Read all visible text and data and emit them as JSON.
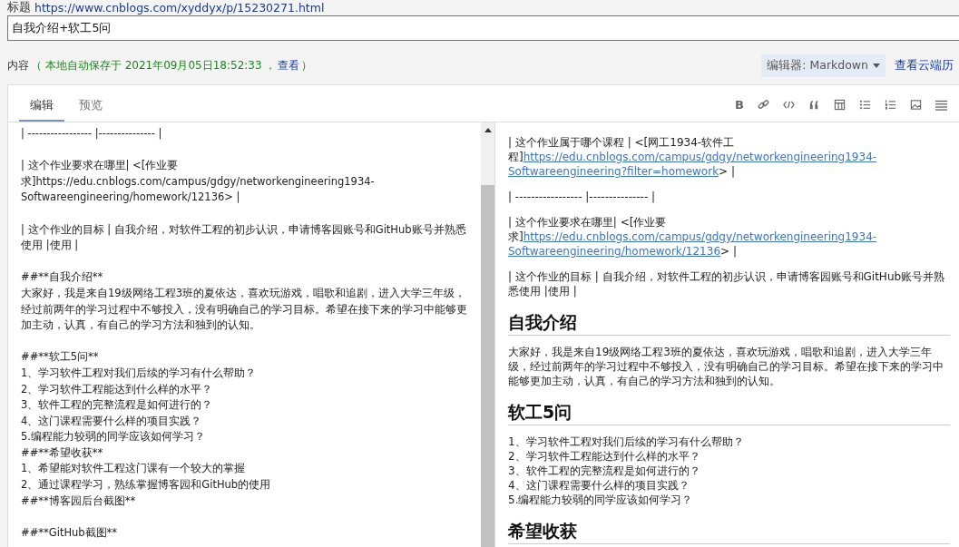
{
  "title_label": "标题",
  "title_url": "https://www.cnblogs.com/xyddyx/p/15230271.html",
  "title_value": "自我介绍+软工5问",
  "content_label": "内容",
  "autosave": {
    "text": "（ 本地自动保存于 2021年09月05日18:52:33 ，",
    "link": "查看",
    "close": "）"
  },
  "editor_select": "编辑器: Markdown",
  "cloud_history": "查看云端历",
  "tabs": [
    {
      "label": "编辑",
      "selected": true
    },
    {
      "label": "预览",
      "selected": false
    }
  ],
  "toolbar": [
    {
      "kind": "bold",
      "label": "B"
    },
    {
      "kind": "link"
    },
    {
      "kind": "code"
    },
    {
      "kind": "quote"
    },
    {
      "kind": "table"
    },
    {
      "kind": "bullets"
    },
    {
      "kind": "numbers"
    },
    {
      "kind": "image"
    },
    {
      "kind": "menu"
    }
  ],
  "source_blocks": [
    [
      "| ----------------- |--------------- |"
    ],
    [
      "| 这个作业要求在哪里| <[作业要求]https://edu.cnblogs.com/campus/gdgy/networkengineering1934-Softwareengineering/homework/12136> |"
    ],
    [
      "| 这个作业的目标 | 自我介绍，对软件工程的初步认识，申请博客园账号和GitHub账号并熟悉使用 |使用 |"
    ],
    [
      "##**自我介绍**",
      "大家好，我是来自19级网络工程3班的夏依达，喜欢玩游戏，唱歌和追剧，进入大学三年级，经过前两年的学习过程中不够投入，没有明确自己的学习目标。希望在接下来的学习中能够更加主动，认真，有自己的学习方法和独到的认知。"
    ],
    [
      "##**软工5问**",
      "1、学习软件工程对我们后续的学习有什么帮助？",
      "2、学习软件工程能达到什么样的水平？",
      "3、软件工程的完整流程是如何进行的？",
      "4、这门课程需要什么样的项目实践？",
      "5.编程能力较弱的同学应该如何学习？",
      "##**希望收获**",
      "1、希望能对软件工程这门课有一个较大的掌握",
      "2、通过课程学习，熟练掌握博客园和GitHub的使用",
      "##**博客园后台截图**"
    ],
    [
      "##**GitHub截图**"
    ]
  ],
  "preview": [
    {
      "kind": "para",
      "lines": [
        [
          {
            "kind": "text",
            "text": "| 这个作业属于哪个课程 | <[网工1934-软件工"
          }
        ],
        [
          {
            "kind": "text",
            "text": "程]"
          },
          {
            "kind": "link",
            "text": "https://edu.cnblogs.com/campus/gdgy/networkengineering1934-"
          }
        ],
        [
          {
            "kind": "link",
            "text": "Softwareengineering?filter=homework"
          },
          {
            "kind": "text",
            "text": "> |"
          }
        ]
      ]
    },
    {
      "kind": "para",
      "lines": [
        [
          {
            "kind": "text",
            "text": "| ----------------- |--------------- |"
          }
        ]
      ]
    },
    {
      "kind": "para",
      "lines": [
        [
          {
            "kind": "text",
            "text": "| 这个作业要求在哪里| <[作业要"
          }
        ],
        [
          {
            "kind": "text",
            "text": "求]"
          },
          {
            "kind": "link",
            "text": "https://edu.cnblogs.com/campus/gdgy/networkengineering1934-"
          }
        ],
        [
          {
            "kind": "link",
            "text": "Softwareengineering/homework/12136"
          },
          {
            "kind": "text",
            "text": "> |"
          }
        ]
      ]
    },
    {
      "kind": "para",
      "lines": [
        [
          {
            "kind": "text",
            "text": "| 这个作业的目标 | 自我介绍，对软件工程的初步认识，申请博客园账号和GitHub账号并熟悉使用 |使用 |"
          }
        ]
      ]
    },
    {
      "kind": "heading",
      "text": "自我介绍"
    },
    {
      "kind": "para",
      "lines": [
        [
          {
            "kind": "text",
            "text": "大家好，我是来自19级网络工程3班的夏依达，喜欢玩游戏，唱歌和追剧，进入大学三年级，经过前两年的学习过程中不够投入，没有明确自己的学习目标。希望在接下来的学习中能够更加主动，认真，有自己的学习方法和独到的认知。"
          }
        ]
      ]
    },
    {
      "kind": "heading",
      "text": "软工5问"
    },
    {
      "kind": "lines",
      "lines": [
        "1、学习软件工程对我们后续的学习有什么帮助？",
        "2、学习软件工程能达到什么样的水平？",
        "3、软件工程的完整流程是如何进行的？",
        "4、这门课程需要什么样的项目实践？",
        "5.编程能力较弱的同学应该如何学习？"
      ]
    },
    {
      "kind": "heading",
      "text": "希望收获"
    }
  ]
}
